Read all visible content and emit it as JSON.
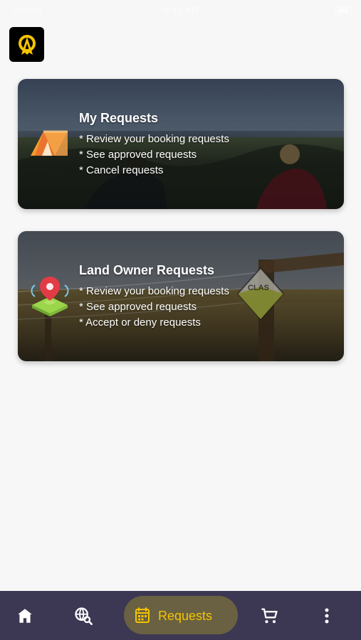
{
  "status": {
    "left": "Search",
    "center": "9:41 AM"
  },
  "cards": [
    {
      "title": "My Requests",
      "bullets": [
        "* Review your booking requests",
        "* See approved requests",
        "* Cancel requests"
      ]
    },
    {
      "title": "Land Owner Requests",
      "bullets": [
        "* Review your booking requests",
        "* See approved requests",
        "* Accept or deny requests"
      ]
    }
  ],
  "nav": {
    "selected_label": "Requests",
    "items": [
      "home",
      "explore",
      "requests",
      "cart",
      "more"
    ]
  },
  "colors": {
    "nav_bg": "#3c3853",
    "nav_selected_bg": "#6a6142",
    "accent": "#f4c400"
  }
}
